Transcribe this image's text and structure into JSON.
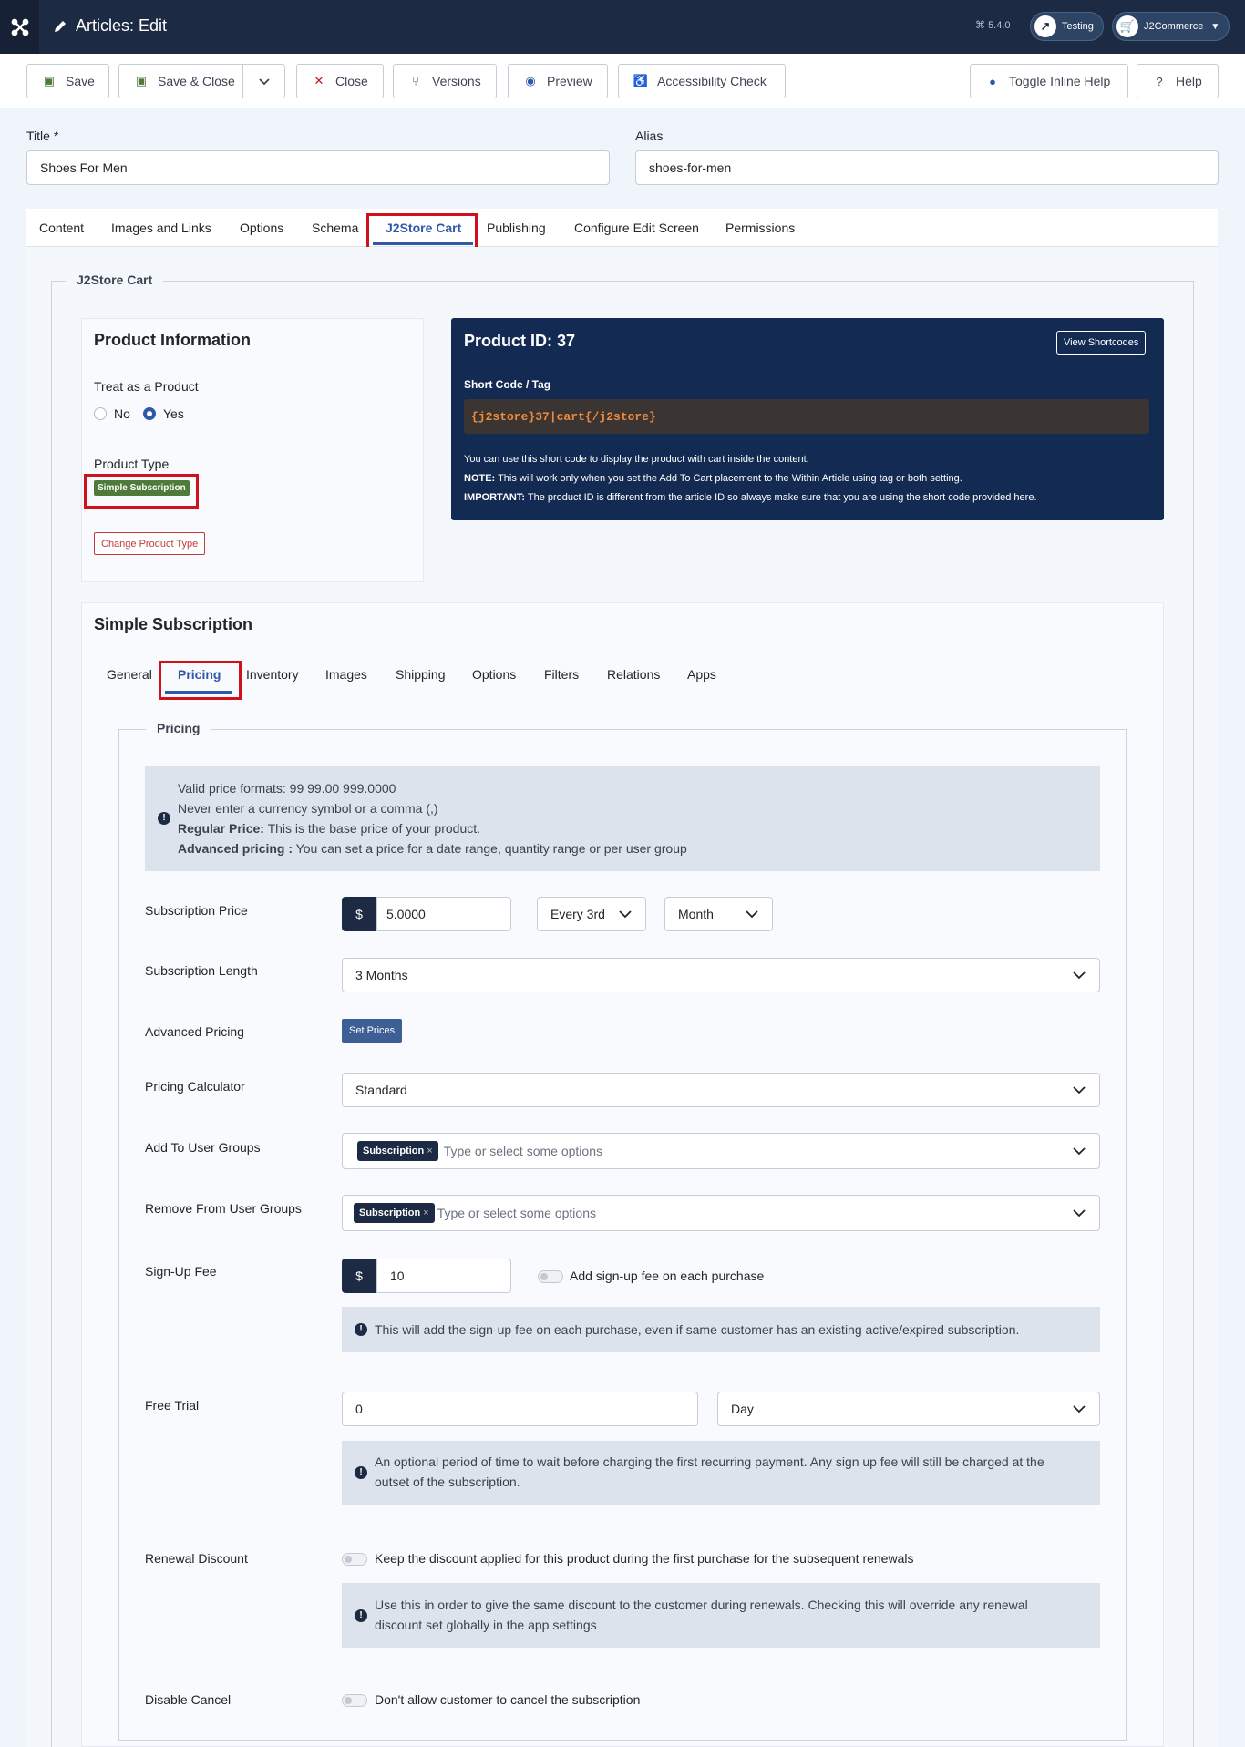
{
  "header": {
    "title": "Articles: Edit",
    "version": "5.4.0",
    "testing_label": "Testing",
    "j2commerce_label": "J2Commerce"
  },
  "toolbar": {
    "save": "Save",
    "save_close": "Save & Close",
    "close": "Close",
    "versions": "Versions",
    "preview": "Preview",
    "accessibility": "Accessibility Check",
    "toggle_help": "Toggle Inline Help",
    "help": "Help"
  },
  "form": {
    "title_label": "Title *",
    "title_value": "Shoes For Men",
    "alias_label": "Alias",
    "alias_value": "shoes-for-men"
  },
  "tabs": [
    "Content",
    "Images and Links",
    "Options",
    "Schema",
    "J2Store Cart",
    "Publishing",
    "Configure Edit Screen",
    "Permissions"
  ],
  "j2store": {
    "legend": "J2Store Cart",
    "product_info_title": "Product Information",
    "treat_label": "Treat as a Product",
    "radio_no": "No",
    "radio_yes": "Yes",
    "product_type_label": "Product Type",
    "product_type_badge": "Simple Subscription",
    "change_type_button": "Change Product Type",
    "product_id_title": "Product ID: 37",
    "view_shortcodes": "View Shortcodes",
    "short_code_label": "Short Code / Tag",
    "short_code_value": "{j2store}37|cart{/j2store}",
    "info_line1": "You can use this short code to display the product with cart inside the content.",
    "note_label": "NOTE:",
    "note_text": " This will work only when you set the Add To Cart placement to the Within Article using tag or both setting.",
    "important_label": "IMPORTANT:",
    "important_text": " The product ID is different from the article ID so always make sure that you are using the short code provided here."
  },
  "subscription": {
    "title": "Simple Subscription",
    "subtabs": [
      "General",
      "Pricing",
      "Inventory",
      "Images",
      "Shipping",
      "Options",
      "Filters",
      "Relations",
      "Apps"
    ],
    "pricing_legend": "Pricing",
    "alert": {
      "line1": "Valid price formats: 99 99.00 999.0000",
      "line2": "Never enter a currency symbol or a comma (,)",
      "regular_label": "Regular Price:",
      "regular_text": " This is the base price of your product.",
      "advanced_label": "Advanced pricing :",
      "advanced_text": " You can set a price for a date range, quantity range or per user group"
    }
  },
  "fields": {
    "currency_symbol": "$",
    "subscription_price_label": "Subscription Price",
    "subscription_price_value": "5.0000",
    "interval_value": "Every 3rd",
    "period_value": "Month",
    "subscription_length_label": "Subscription Length",
    "subscription_length_value": "3 Months",
    "advanced_pricing_label": "Advanced Pricing",
    "set_prices_button": "Set Prices",
    "pricing_calculator_label": "Pricing Calculator",
    "pricing_calculator_value": "Standard",
    "add_groups_label": "Add To User Groups",
    "add_groups_chip": "Subscription",
    "add_groups_placeholder": "Type or select some options",
    "remove_groups_label": "Remove From User Groups",
    "remove_groups_chip": "Subscription",
    "remove_groups_placeholder": "Type or select some options",
    "signup_fee_label": "Sign-Up Fee",
    "signup_fee_value": "10",
    "signup_toggle_label": "Add sign-up fee on each purchase",
    "signup_alert": "This will add the sign-up fee on each purchase, even if same customer has an existing active/expired subscription.",
    "free_trial_label": "Free Trial",
    "free_trial_value": "0",
    "free_trial_unit": "Day",
    "free_trial_alert": "An optional period of time to wait before charging the first recurring payment. Any sign up fee will still be charged at the outset of the subscription.",
    "renewal_discount_label": "Renewal Discount",
    "renewal_toggle_label": "Keep the discount applied for this product during the first purchase for the subsequent renewals",
    "renewal_alert": "Use this in order to give the same discount to the customer during renewals. Checking this will override any renewal discount set globally in the app settings",
    "disable_cancel_label": "Disable Cancel",
    "disable_cancel_toggle_label": "Don't allow customer to cancel the subscription"
  },
  "colors": {
    "header_bg": "#1c2a44",
    "highlight_red": "#d0111b",
    "badge_green": "#4e7a3a",
    "shortcode_orange": "#f08a3c"
  }
}
